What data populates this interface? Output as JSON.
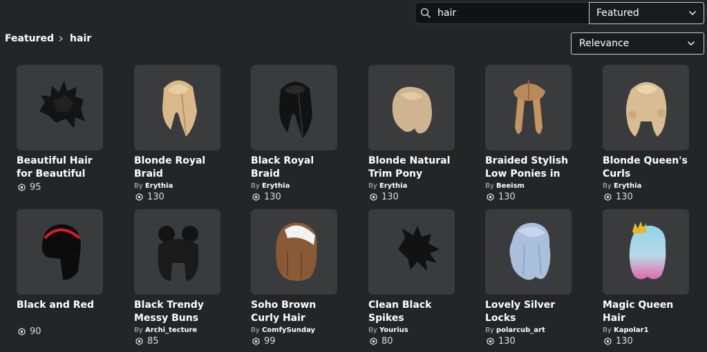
{
  "search": {
    "value": "hair",
    "placeholder": "Search"
  },
  "filters": {
    "category": "Featured",
    "sort": "Relevance"
  },
  "breadcrumb": {
    "parent": "Featured",
    "current": "hair"
  },
  "colors": {
    "background": "#232527",
    "card": "#393b3d",
    "text": "#ffffff"
  },
  "items": [
    {
      "name": "Beautiful Hair for Beautiful People",
      "by": "",
      "creator": "",
      "price": "95",
      "icon": "black-spiky-hair-icon"
    },
    {
      "name": "Blonde Royal Braid",
      "by": "By",
      "creator": "Erythia",
      "price": "130",
      "icon": "blonde-braid-hair-icon"
    },
    {
      "name": "Black Royal Braid",
      "by": "By",
      "creator": "Erythia",
      "price": "130",
      "icon": "black-braid-hair-icon"
    },
    {
      "name": "Blonde Natural Trim Pony",
      "by": "By",
      "creator": "Erythia",
      "price": "130",
      "icon": "blonde-pony-hair-icon"
    },
    {
      "name": "Braided Stylish Low Ponies in",
      "by": "By",
      "creator": "Beeism",
      "price": "130",
      "icon": "braided-ponies-hair-icon"
    },
    {
      "name": "Blonde Queen's Curls",
      "by": "By",
      "creator": "Erythia",
      "price": "130",
      "icon": "blonde-curls-hair-icon"
    },
    {
      "name": "Black and Red",
      "by": "",
      "creator": "",
      "price": "90",
      "icon": "black-red-hair-icon"
    },
    {
      "name": "Black Trendy Messy Buns",
      "by": "By",
      "creator": "Archi_tecture",
      "price": "85",
      "icon": "black-buns-hair-icon"
    },
    {
      "name": "Soho Brown Curly Hair",
      "by": "By",
      "creator": "ComfySunday",
      "price": "99",
      "icon": "brown-curly-hair-icon"
    },
    {
      "name": "Clean Black Spikes",
      "by": "By",
      "creator": "Yourius",
      "price": "80",
      "icon": "black-spikes-hair-icon"
    },
    {
      "name": "Lovely Silver Locks",
      "by": "By",
      "creator": "polarcub_art",
      "price": "130",
      "icon": "silver-locks-hair-icon"
    },
    {
      "name": "Magic Queen Hair",
      "by": "By",
      "creator": "Kapolar1",
      "price": "130",
      "icon": "magic-queen-hair-icon"
    }
  ]
}
